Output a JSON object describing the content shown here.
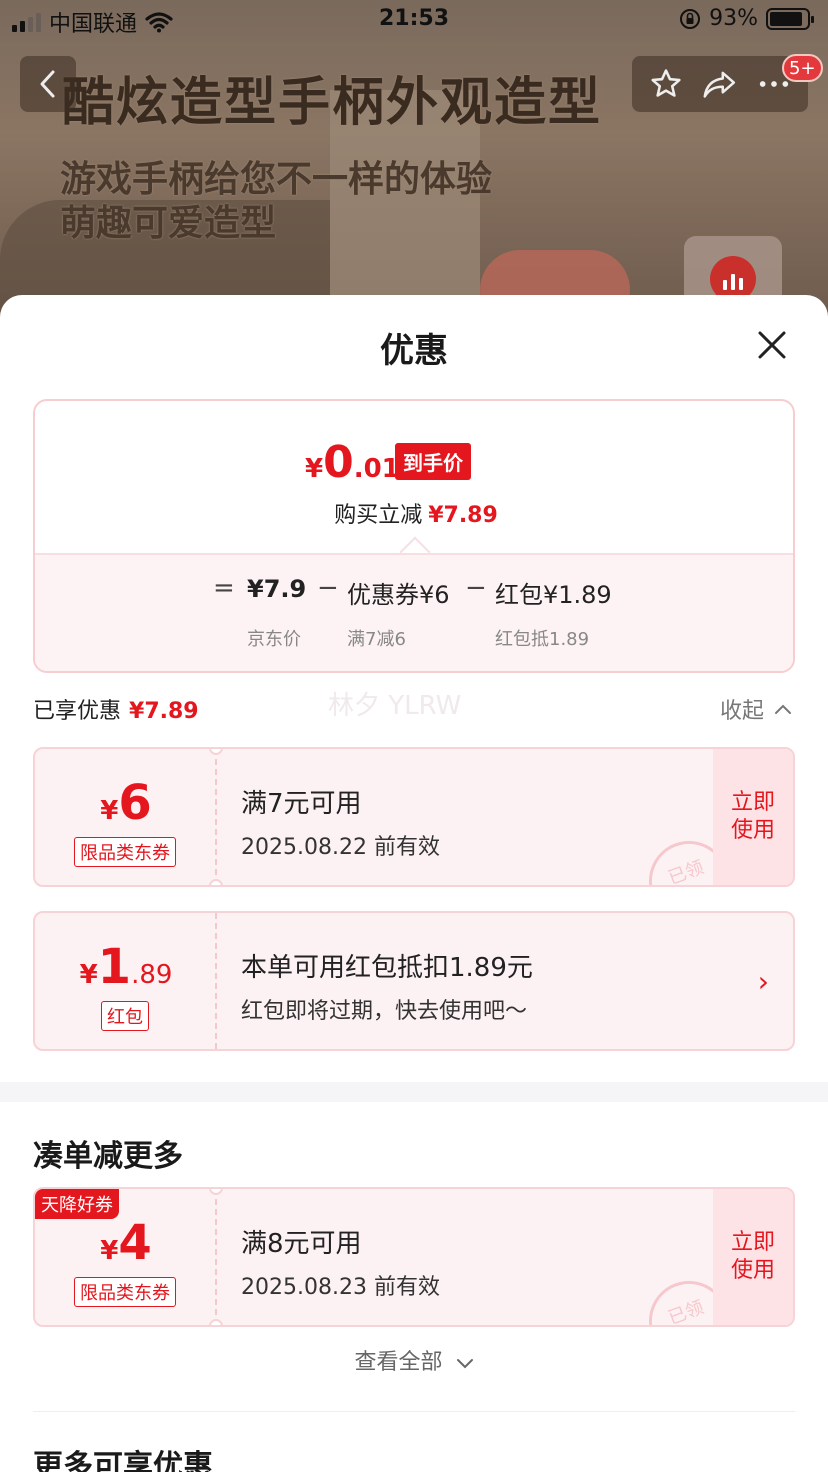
{
  "status_bar": {
    "carrier": "中国联通",
    "time": "21:53",
    "battery": "93%"
  },
  "product_banner": {
    "headline": "酷炫造型手柄外观造型",
    "sub_line_1": "游戏手柄给您不一样的体验",
    "sub_line_2": "萌趣可爱造型",
    "cart_badge": "5+"
  },
  "sheet": {
    "title": "优惠",
    "final_price": {
      "currency": "¥",
      "integer": "0",
      "decimal": ".01",
      "tag": "到手价"
    },
    "instant_discount": {
      "label": "购买立减",
      "value": "¥7.89"
    },
    "formula": {
      "eq": "=",
      "jd_price": "¥7.9",
      "jd_price_label": "京东价",
      "minus1": "−",
      "coupon": "优惠券¥6",
      "coupon_label": "满7减6",
      "minus2": "−",
      "redpacket": "红包¥1.89",
      "redpacket_label": "红包抵1.89"
    },
    "enjoyed": {
      "label": "已享优惠",
      "value": "¥7.89",
      "toggle": "收起"
    },
    "watermark": "林夕 YLRW",
    "coupons": [
      {
        "currency": "¥",
        "integer": "6",
        "decimal": "",
        "chip": "限品类东券",
        "line1": "满7元可用",
        "line2": "2025.08.22 前有效",
        "action_1": "立即",
        "action_2": "使用",
        "stamp": "已领"
      },
      {
        "currency": "¥",
        "integer": "1",
        "decimal": ".89",
        "chip": "红包",
        "line1": "本单可用红包抵扣1.89元",
        "line2": "红包即将过期，快去使用吧～",
        "arrow": "›"
      }
    ],
    "section_more": "凑单减更多",
    "more_coupon": {
      "tag": "天降好券",
      "currency": "¥",
      "integer": "4",
      "chip": "限品类东券",
      "line1": "满8元可用",
      "line2": "2025.08.23 前有效",
      "action_1": "立即",
      "action_2": "使用",
      "stamp": "已领"
    },
    "view_all": "查看全部",
    "section_more2": "更多可享优惠"
  }
}
